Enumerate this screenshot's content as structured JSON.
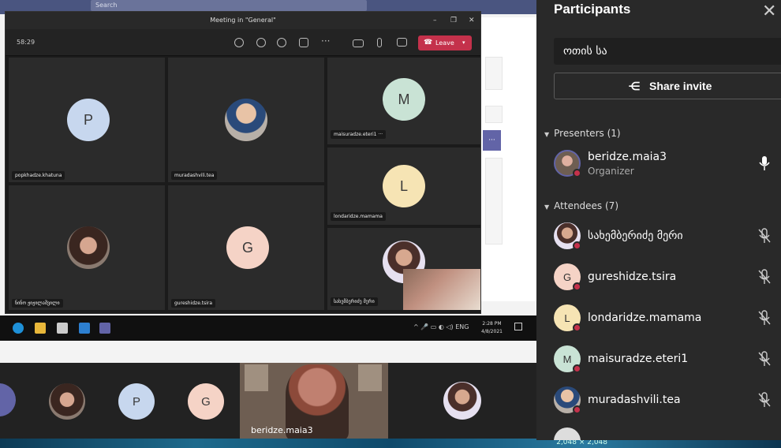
{
  "desktop": {
    "search_placeholder": "Search"
  },
  "meeting": {
    "title": "Meeting in \"General\"",
    "time": "58:29",
    "leave_label": "Leave",
    "tiles": [
      {
        "name": "popkhadze.khatuna",
        "initial": "P",
        "color": "#c7d7ee"
      },
      {
        "name": "muradashvili.tea"
      },
      {
        "name": "maisuradze.eteri1",
        "initial": "M",
        "color": "#c9e3d5"
      },
      {
        "name": "londaridze.mamama",
        "initial": "L",
        "color": "#f6e4b4"
      },
      {
        "name": "ნინო ჟიჟილაშვილი"
      },
      {
        "name": "gureshidze.tsira",
        "initial": "G",
        "color": "#f5d3c6"
      },
      {
        "name": "სახემბერიძე მერი"
      }
    ],
    "clock_time": "2:28 PM",
    "clock_date": "4/8/2021"
  },
  "gallery": {
    "speaker_name": "beridze.maia3",
    "avatars": [
      {
        "initial": "P",
        "color": "#c7d7ee"
      },
      {
        "initial": "G",
        "color": "#f5d3c6"
      }
    ]
  },
  "water_text": "2,048 × 2,048",
  "panel": {
    "title": "Participants",
    "search_value": "ოთის სა",
    "share_label": "Share invite",
    "presenters_label": "Presenters (1)",
    "attendees_label": "Attendees (7)",
    "organizer": {
      "name": "beridze.maia3",
      "role": "Organizer"
    },
    "attendees": [
      {
        "name": "სახემბერიძე მერი"
      },
      {
        "name": "gureshidze.tsira",
        "initial": "G",
        "color": "#f5d3c6"
      },
      {
        "name": "londaridze.mamama",
        "initial": "L",
        "color": "#f6e4b4"
      },
      {
        "name": "maisuradze.eteri1",
        "initial": "M",
        "color": "#c9e3d5"
      },
      {
        "name": "muradashvili.tea"
      }
    ]
  }
}
